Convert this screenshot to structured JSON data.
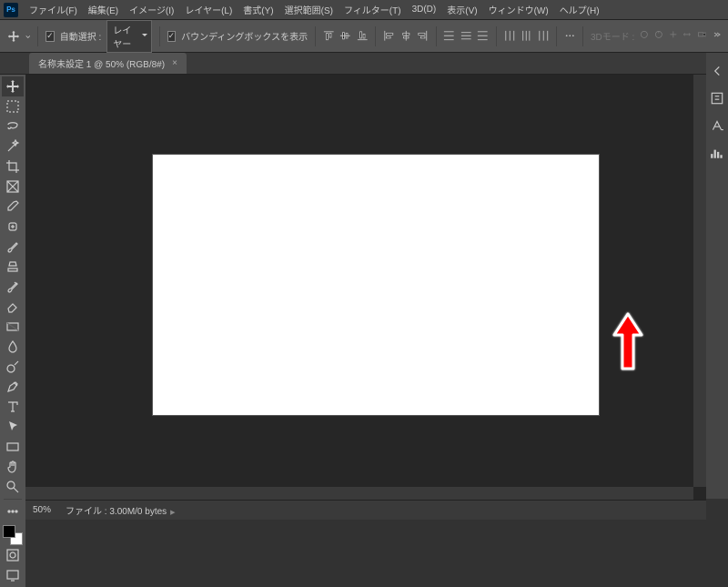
{
  "app": {
    "logo": "Ps"
  },
  "menu": {
    "file": "ファイル(F)",
    "edit": "編集(E)",
    "image": "イメージ(I)",
    "layer": "レイヤー(L)",
    "type": "書式(Y)",
    "select": "選択範囲(S)",
    "filter": "フィルター(T)",
    "threed": "3D(D)",
    "view": "表示(V)",
    "window": "ウィンドウ(W)",
    "help": "ヘルプ(H)"
  },
  "options": {
    "auto_select_label": "自動選択 :",
    "target_dropdown": "レイヤー",
    "bounding_label": "バウンディングボックスを表示",
    "mode3d_label": "3Dモード :"
  },
  "tab": {
    "title": "名称未設定 1 @ 50% (RGB/8#)",
    "close": "×"
  },
  "tools": [
    "move",
    "marquee",
    "lasso",
    "magic-wand",
    "crop",
    "frame",
    "eyedropper",
    "healing",
    "brush",
    "clone",
    "history-brush",
    "eraser",
    "gradient",
    "blur",
    "dodge",
    "pen",
    "type",
    "path-select",
    "rectangle",
    "hand",
    "zoom"
  ],
  "status": {
    "zoom": "50%",
    "info": "ファイル : 3.00M/0 bytes"
  },
  "right_panel_icons": [
    "properties",
    "character",
    "histogram"
  ]
}
